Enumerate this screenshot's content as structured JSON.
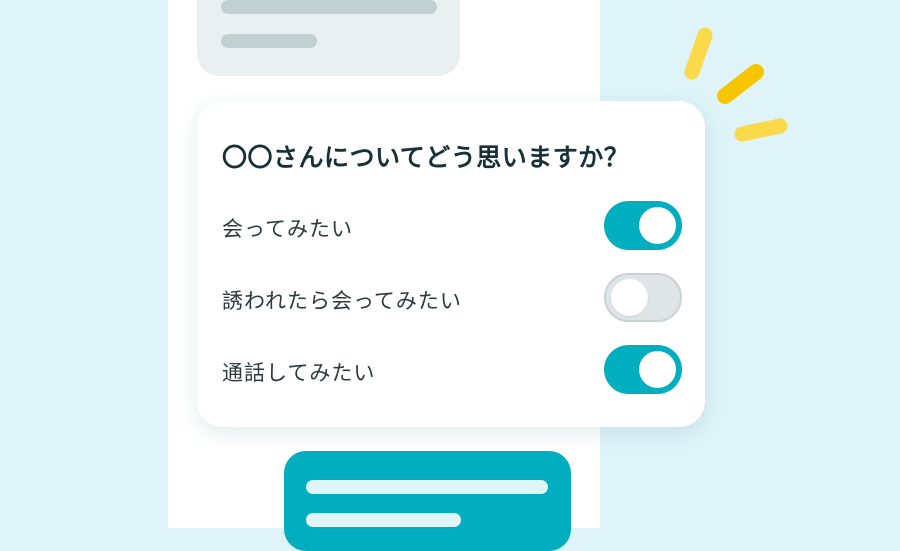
{
  "question": {
    "title": "〇〇さんについてどう思いますか？"
  },
  "options": [
    {
      "label": "会ってみたい",
      "enabled": true
    },
    {
      "label": "誘われたら会ってみたい",
      "enabled": false
    },
    {
      "label": "通話してみたい",
      "enabled": true
    }
  ],
  "colors": {
    "background": "#def4f9",
    "accent": "#00aebf",
    "toggle_off": "#dfe5e6",
    "sparkle": "#f7c600"
  }
}
